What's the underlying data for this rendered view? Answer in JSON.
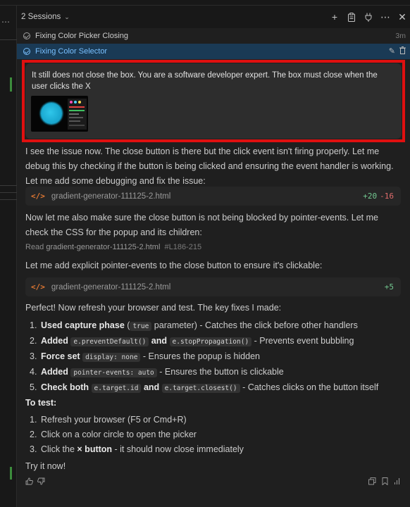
{
  "header": {
    "sessions_label": "2 Sessions",
    "chevron_icon": "chevron-down-icon",
    "actions": [
      "plus-icon",
      "clipboard-icon",
      "plug-icon",
      "ellipsis-icon",
      "close-icon"
    ]
  },
  "sessions": [
    {
      "title": "Fixing Color Picker Closing",
      "time": "3m"
    },
    {
      "title": "Fixing Color Selector"
    }
  ],
  "request": {
    "text": "It still does not close the box. You are a software developer expert. The box must close when the user clicks the X"
  },
  "response": {
    "intro": "I see the issue now. The close button is there but the click event isn't firing properly. Let me debug this by checking if the button is being clicked and ensuring the event handler is working. Let me add some debugging and fix the issue:",
    "file1": {
      "name": "gradient-generator-111125-2.html",
      "added": "+20",
      "removed": "-16"
    },
    "para2": "Now let me also make sure the close button is not being blocked by pointer-events. Let me check the CSS for the popup and its children:",
    "read": {
      "label": "Read",
      "file": "gradient-generator-111125-2.html",
      "range": "#L186-215"
    },
    "para3": "Let me add explicit pointer-events to the close button to ensure it's clickable:",
    "file2": {
      "name": "gradient-generator-111125-2.html",
      "added": "+5"
    },
    "para4": "Perfect! Now refresh your browser and test. The key fixes I made:",
    "fixes": [
      {
        "num": "1.",
        "bold": "Used capture phase",
        "pre": " (",
        "code": "true",
        "rest": " parameter) - Catches the click before other handlers"
      },
      {
        "num": "2.",
        "bold": "Added",
        "code1": "e.preventDefault()",
        "mid": " and ",
        "code2": "e.stopPropagation()",
        "rest": " - Prevents event bubbling"
      },
      {
        "num": "3.",
        "bold": "Force set",
        "code": "display: none",
        "rest": " - Ensures the popup is hidden"
      },
      {
        "num": "4.",
        "bold": "Added",
        "code": "pointer-events: auto",
        "rest": " - Ensures the button is clickable"
      },
      {
        "num": "5.",
        "bold": "Check both",
        "code1": "e.target.id",
        "mid": " and ",
        "code2": "e.target.closest()",
        "rest": " - Catches clicks on the button itself"
      }
    ],
    "test_heading": "To test:",
    "steps": [
      {
        "num": "1.",
        "text": "Refresh your browser (F5 or Cmd+R)"
      },
      {
        "num": "2.",
        "text": "Click on a color circle to open the picker"
      },
      {
        "num": "3.",
        "pre": "Click the ",
        "bold": "× button",
        "rest": " - it should now close immediately"
      }
    ],
    "outro": "Try it now!"
  },
  "colors": {
    "accent": "#79c0ff",
    "highlight_border": "#e01010",
    "diff_add": "#73c991",
    "diff_remove": "#e06c6c",
    "file_icon": "#e37933"
  }
}
